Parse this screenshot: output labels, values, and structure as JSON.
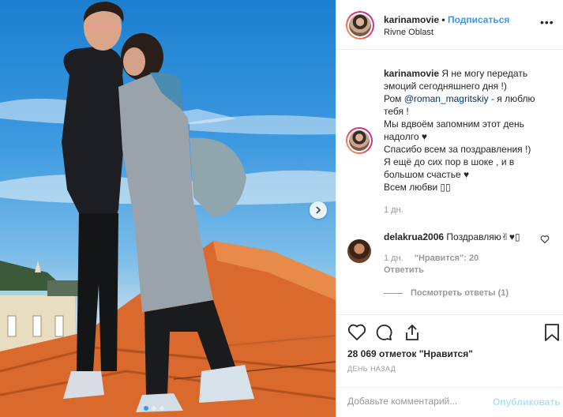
{
  "post": {
    "username": "karinamovie",
    "separator": "•",
    "follow_label": "Подписаться",
    "location": "Rivne Oblast",
    "more_label": "•••"
  },
  "caption": {
    "username": "karinamovie",
    "line1": "Я не могу передать эмоций сегодняшнего дня !)",
    "line2_pre": "Ром",
    "mention": "@roman_magritskiy",
    "line2_post": "- я люблю тебя !",
    "line3": "Мы вдвоём запомним этот день надолго ♥",
    "line4": "Спасибо всем за поздравления !)",
    "line5": "Я ещё до сих пор в шоке , и в большом счастье ♥",
    "line6": "Всем любви ▯▯",
    "time": "1 дн."
  },
  "comment": {
    "username": "delakrua2006",
    "text": "Поздравляю✌♥▯",
    "time": "1 дн.",
    "likes": "\"Нравится\": 20",
    "reply_label": "Ответить",
    "view_replies": "Посмотреть ответы (1)"
  },
  "actions": {
    "likes_text": "28 069 отметок \"Нравится\"",
    "date_text": "ДЕНЬ НАЗАД"
  },
  "add_comment": {
    "placeholder": "Добавьте комментарий...",
    "publish_label": "Опубликовать"
  },
  "carousel": {
    "slides": 3,
    "active": 1
  },
  "colors": {
    "accent": "#3897f0",
    "mention": "#003569",
    "muted": "#999999",
    "roof": "#e07a3a"
  }
}
